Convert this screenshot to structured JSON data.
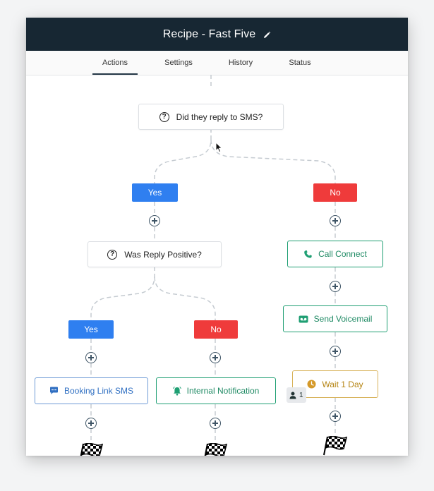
{
  "header": {
    "title": "Recipe - Fast Five"
  },
  "tabs": [
    {
      "label": "Actions",
      "active": true
    },
    {
      "label": "Settings"
    },
    {
      "label": "History"
    },
    {
      "label": "Status"
    }
  ],
  "flow": {
    "condition_1": {
      "text": "Did they reply to SMS?",
      "icon": "question-circle-icon"
    },
    "condition_2": {
      "text": "Was Reply Positive?",
      "icon": "question-circle-icon"
    },
    "branches": {
      "yes_label": "Yes",
      "no_label": "No"
    },
    "actions": {
      "booking_link_sms": {
        "text": "Booking Link SMS",
        "icon": "chat-bubble-icon"
      },
      "internal_notification": {
        "text": "Internal Notification",
        "icon": "bell-icon"
      },
      "call_connect": {
        "text": "Call Connect",
        "icon": "phone-icon"
      },
      "send_voicemail": {
        "text": "Send Voicemail",
        "icon": "voicemail-icon"
      },
      "wait": {
        "text": "Wait 1 Day",
        "icon": "clock-icon",
        "badge_count": "1"
      }
    },
    "end_icon": "checkered-flag-icon"
  },
  "colors": {
    "header_bg": "#172733",
    "yes": "#2f7ff0",
    "no": "#ef3b3b",
    "green": "#1f9f73",
    "blue": "#6f9bd6",
    "orange": "#d8b25a"
  }
}
